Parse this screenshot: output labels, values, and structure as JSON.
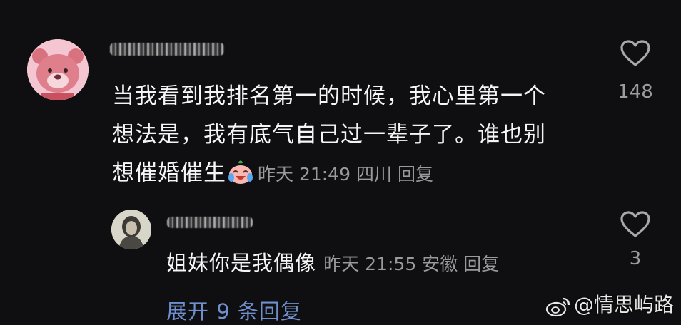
{
  "comment": {
    "text_line1": "当我看到我排名第一的时候，我心里第一个",
    "text_line2": "想法是，我有底气自己过一辈子了。谁也别",
    "text_line3": "想催婚催生",
    "emoji": "crying-laughing-emoji",
    "time": "昨天 21:49",
    "location": "四川",
    "reply_label": "回复",
    "like_count": "148"
  },
  "reply": {
    "text": "姐妹你是我偶像",
    "time": "昨天 21:55",
    "location": "安徽",
    "reply_label": "回复",
    "like_count": "3"
  },
  "expand_label": "展开 9 条回复",
  "watermark": "@情思屿路",
  "colors": {
    "background": "#0f0f11",
    "text": "#f5f5f5",
    "meta": "#9a9a9a",
    "link": "#6f8fcf"
  }
}
